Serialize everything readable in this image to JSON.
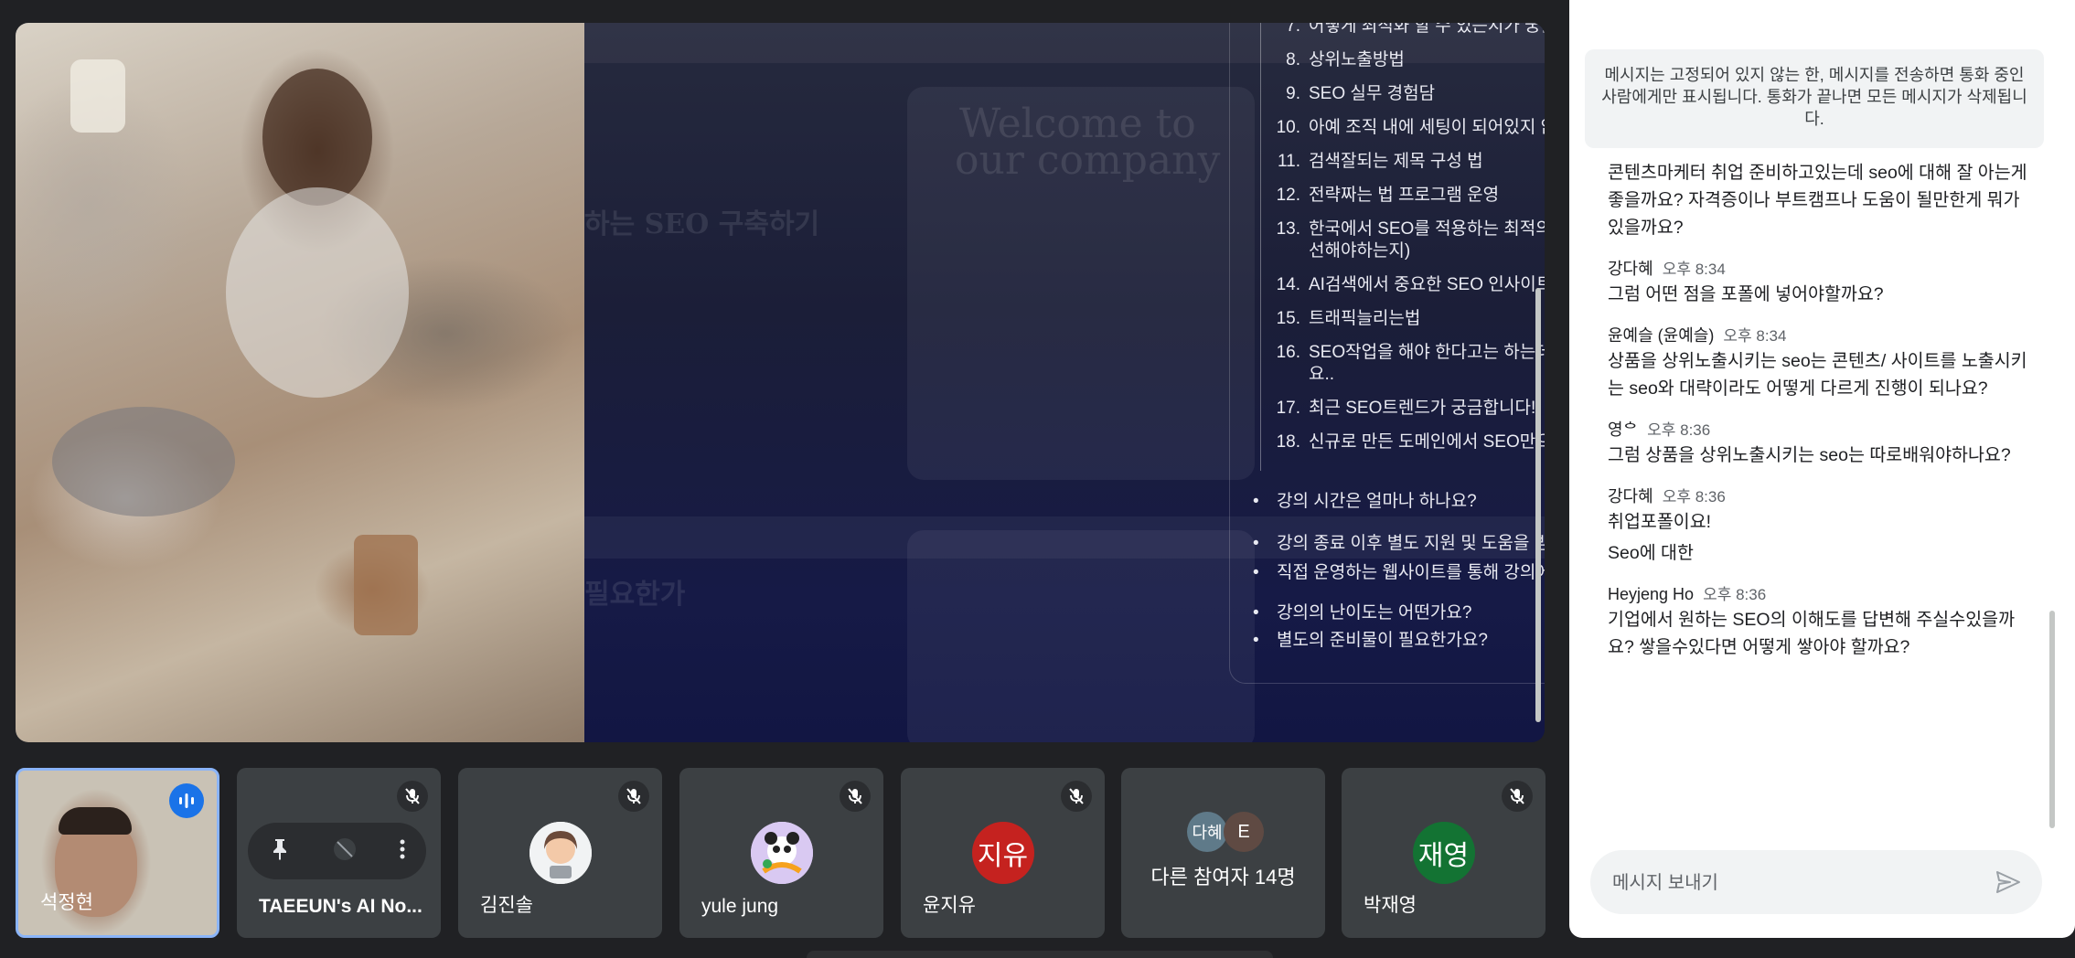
{
  "presentation": {
    "numbered_questions": [
      {
        "num": "7.",
        "text": "어떻게 최적화 할 수 있는지가 궁금합니다"
      },
      {
        "num": "8.",
        "text": "상위노출방법"
      },
      {
        "num": "9.",
        "text": "SEO 실무 경험담"
      },
      {
        "num": "10.",
        "text": "아예 조직 내에 세팅이 되어있지 않아요. 이럴 땐 어떤 것부터 해야 할까요??ㅜㅜ"
      },
      {
        "num": "11.",
        "text": "검색잘되는 제목 구성 법"
      },
      {
        "num": "12.",
        "text": "전략짜는 법 프로그램 운영"
      },
      {
        "num": "13.",
        "text": "한국에서 SEO를 적용하는 최적의 방법(네이버에서 가능한지, 어느 플랫폼을 최우선으로 선택 개선해야하는지)"
      },
      {
        "num": "14.",
        "text": "AI검색에서 중요한 SEO 인사이트"
      },
      {
        "num": "15.",
        "text": "트래픽늘리는법"
      },
      {
        "num": "16.",
        "text": "SEO작업을 해야 한다고는 하는데 제가 업무에서 하고 있는게 SEO인지 명확하게 와닿지가 않아요.."
      },
      {
        "num": "17.",
        "text": "최근 SEO트렌드가 궁금합니다!"
      },
      {
        "num": "18.",
        "text": "신규로 만든 도메인에서 SEO만으로 지속적인 유입을 만드는데까지 얼마나 시간이 필요한지"
      }
    ],
    "bullet_questions": [
      "강의 시간은 얼마나 하나요?",
      "강의 종료 이후 별도 지원 및 도움을 받을 수 없나요?",
      "직접 운영하는 웹사이트를 통해 강의에 참여해도 괜찮나요?",
      "강의의 난이도는 어떤가요?",
      "별도의 준비물이 필요한가요?"
    ]
  },
  "participants": [
    {
      "name": "석정현",
      "type": "video",
      "speaking": true
    },
    {
      "name": "TAEEUN's AI No...",
      "type": "ai-notetaker",
      "muted": true
    },
    {
      "name": "김진솔",
      "type": "avatar-image",
      "muted": true
    },
    {
      "name": "yule jung",
      "type": "avatar-image",
      "muted": true
    },
    {
      "name": "윤지유",
      "type": "initial",
      "initial": "지유",
      "color": "#c5221f",
      "muted": true
    },
    {
      "name": "다른 참여자 14명",
      "type": "group",
      "initials": [
        "다혜",
        "E"
      ]
    },
    {
      "name": "박재영",
      "type": "initial",
      "initial": "재영",
      "color": "#137333",
      "muted": true
    }
  ],
  "chat": {
    "notice": "메시지는 고정되어 있지 않는 한, 메시지를 전송하면 통화 중인 사람에게만 표시됩니다. 통화가 끝나면 모든 메시지가 삭제됩니다.",
    "messages": [
      {
        "sender": "",
        "time": "",
        "texts": [
          "콘텐츠마케터 취업 준비하고있는데 seo에 대해 잘 아는게 좋을까요? 자격증이나 부트캠프나 도움이 될만한게 뭐가있을까요?"
        ]
      },
      {
        "sender": "강다혜",
        "time": "오후 8:34",
        "texts": [
          "그럼 어떤 점을 포폴에 넣어야할까요?"
        ]
      },
      {
        "sender": "윤예슬 (윤예슬)",
        "time": "오후 8:34",
        "texts": [
          "상품을 상위노출시키는 seo는 콘텐츠/ 사이트를 노출시키는 seo와 대략이라도 어떻게 다르게 진행이 되나요?"
        ]
      },
      {
        "sender": "영ᅌ",
        "time": "오후 8:36",
        "texts": [
          "그럼 상품을 상위노출시키는 seo는 따로배워야하나요?"
        ]
      },
      {
        "sender": "강다혜",
        "time": "오후 8:36",
        "texts": [
          "취업포폴이요!",
          "Seo에 대한"
        ]
      },
      {
        "sender": "Heyjeng Ho",
        "time": "오후 8:36",
        "texts": [
          "기업에서 원하는 SEO의 이해도를 답변해 주실수있을까요? 쌓을수있다면 어떻게 쌓아야 할까요?"
        ]
      }
    ],
    "input_placeholder": "메시지 보내기"
  },
  "colors": {
    "accent": "#1a73e8",
    "tile": "#3c4043",
    "background": "#202124"
  }
}
